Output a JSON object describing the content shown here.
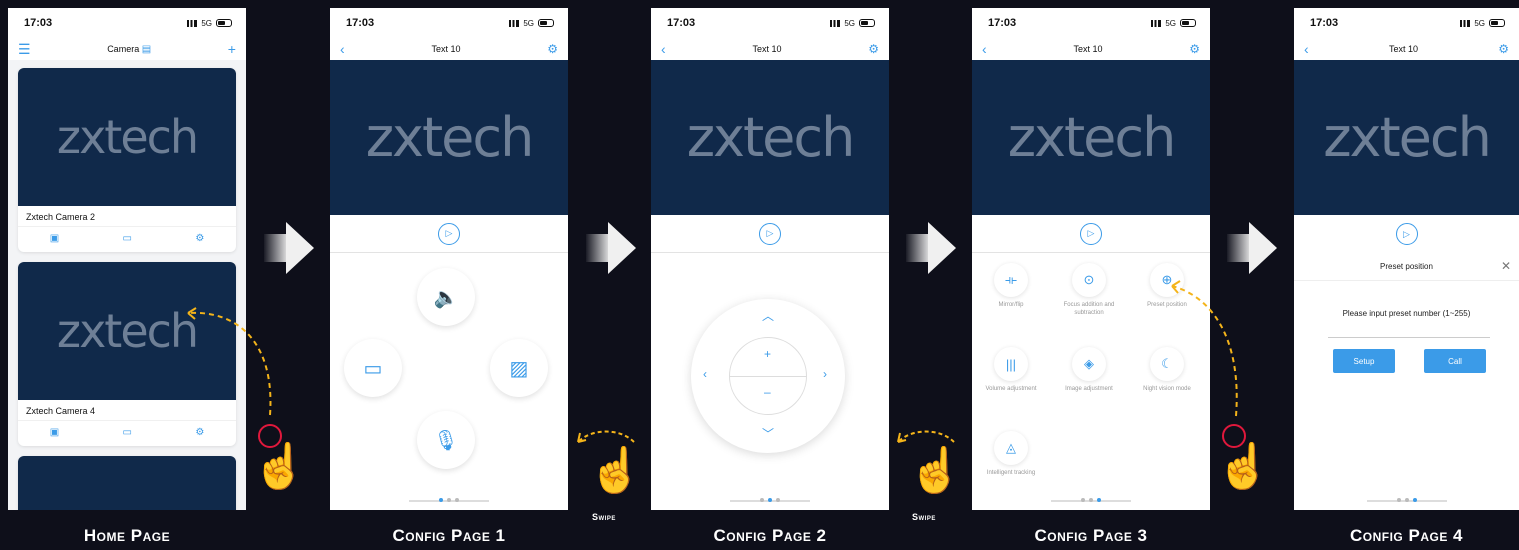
{
  "status": {
    "time": "17:03",
    "network": "5G"
  },
  "home": {
    "title": "Camera",
    "logo": "zxtech",
    "cameras": [
      {
        "name": "Zxtech Camera 2"
      },
      {
        "name": "Zxtech Camera 4"
      }
    ]
  },
  "config": {
    "title": "Text 10",
    "logo": "zxtech"
  },
  "page3": {
    "items": [
      {
        "label": "Mirror/flip",
        "icon": "mirror-icon"
      },
      {
        "label": "Focus addition and subtraction",
        "icon": "focus-icon"
      },
      {
        "label": "Preset position",
        "icon": "crosshair-icon"
      },
      {
        "label": "Volume adjustment",
        "icon": "volume-bars-icon"
      },
      {
        "label": "Image adjustment",
        "icon": "image-adjust-icon"
      },
      {
        "label": "Night vision mode",
        "icon": "moon-icon"
      },
      {
        "label": "Intelligent tracking",
        "icon": "location-icon"
      }
    ]
  },
  "page4": {
    "dialog_title": "Preset position",
    "prompt": "Please input preset number (1~255)",
    "setup_label": "Setup",
    "call_label": "Call"
  },
  "captions": {
    "home": "Home Page",
    "config1": "Config Page 1",
    "config2": "Config Page 2",
    "config3": "Config Page 3",
    "config4": "Config Page 4",
    "swipe": "Swipe"
  },
  "colors": {
    "accent": "#3b9be8",
    "camera_bg": "#10294a",
    "tap_ring": "#e0183c",
    "path": "#f4b41a"
  }
}
